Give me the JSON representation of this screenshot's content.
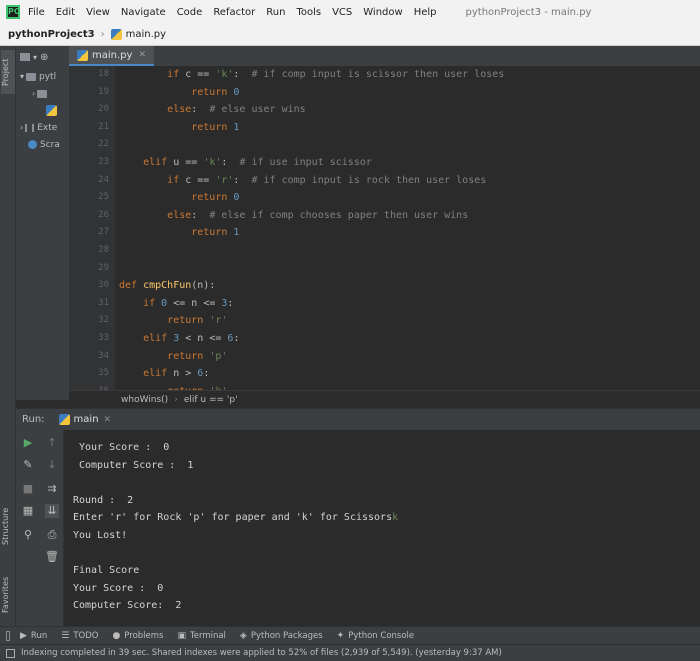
{
  "menubar": {
    "app_icon": "pycharm-logo",
    "items": [
      "File",
      "Edit",
      "View",
      "Navigate",
      "Code",
      "Refactor",
      "Run",
      "Tools",
      "VCS",
      "Window",
      "Help"
    ],
    "window_title": "pythonProject3 - main.py"
  },
  "navbar": {
    "project": "pythonProject3",
    "file": "main.py"
  },
  "left_strip": {
    "project_tab": "Project",
    "structure_tab": "Structure",
    "favorites_tab": "Favorites"
  },
  "project_panel": {
    "rows": [
      {
        "label": "pytl"
      },
      {
        "label": ""
      },
      {
        "label": ""
      },
      {
        "label": "Exte"
      },
      {
        "label": "Scra"
      }
    ]
  },
  "editor": {
    "tab": "main.py",
    "code_lines": [
      {
        "n": "18",
        "segments": [
          [
            "",
            "        "
          ],
          [
            "kw",
            "if"
          ],
          [
            "",
            " c == "
          ],
          [
            "str",
            "'k'"
          ],
          [
            "",
            ":  "
          ],
          [
            "cmt",
            "# if comp input is scissor then user loses"
          ]
        ]
      },
      {
        "n": "19",
        "segments": [
          [
            "",
            "            "
          ],
          [
            "kw",
            "return"
          ],
          [
            "",
            " "
          ],
          [
            "num",
            "0"
          ]
        ]
      },
      {
        "n": "20",
        "segments": [
          [
            "",
            "        "
          ],
          [
            "kw",
            "else"
          ],
          [
            "",
            ":  "
          ],
          [
            "cmt",
            "# else user wins"
          ]
        ]
      },
      {
        "n": "21",
        "segments": [
          [
            "",
            "            "
          ],
          [
            "kw",
            "return"
          ],
          [
            "",
            " "
          ],
          [
            "num",
            "1"
          ]
        ]
      },
      {
        "n": "22",
        "segments": []
      },
      {
        "n": "23",
        "segments": [
          [
            "",
            "    "
          ],
          [
            "kw",
            "elif"
          ],
          [
            "",
            " u == "
          ],
          [
            "str",
            "'k'"
          ],
          [
            "",
            ":  "
          ],
          [
            "cmt",
            "# if use input scissor"
          ]
        ]
      },
      {
        "n": "24",
        "segments": [
          [
            "",
            "        "
          ],
          [
            "kw",
            "if"
          ],
          [
            "",
            " c == "
          ],
          [
            "str",
            "'r'"
          ],
          [
            "",
            ":  "
          ],
          [
            "cmt",
            "# if comp input is rock then user loses"
          ]
        ]
      },
      {
        "n": "25",
        "segments": [
          [
            "",
            "            "
          ],
          [
            "kw",
            "return"
          ],
          [
            "",
            " "
          ],
          [
            "num",
            "0"
          ]
        ]
      },
      {
        "n": "26",
        "segments": [
          [
            "",
            "        "
          ],
          [
            "kw",
            "else"
          ],
          [
            "",
            ":  "
          ],
          [
            "cmt",
            "# else if comp chooses paper then user wins"
          ]
        ]
      },
      {
        "n": "27",
        "segments": [
          [
            "",
            "            "
          ],
          [
            "kw",
            "return"
          ],
          [
            "",
            " "
          ],
          [
            "num",
            "1"
          ]
        ]
      },
      {
        "n": "28",
        "segments": []
      },
      {
        "n": "29",
        "segments": []
      },
      {
        "n": "30",
        "segments": [
          [
            "kw",
            "def"
          ],
          [
            "",
            " "
          ],
          [
            "fn",
            "cmpChFun"
          ],
          [
            "",
            "(n):"
          ]
        ]
      },
      {
        "n": "31",
        "segments": [
          [
            "",
            "    "
          ],
          [
            "kw",
            "if"
          ],
          [
            "",
            " "
          ],
          [
            "num",
            "0"
          ],
          [
            "",
            " <= n <= "
          ],
          [
            "num",
            "3"
          ],
          [
            "",
            ":"
          ]
        ]
      },
      {
        "n": "32",
        "segments": [
          [
            "",
            "        "
          ],
          [
            "kw",
            "return"
          ],
          [
            "",
            " "
          ],
          [
            "str",
            "'r'"
          ]
        ]
      },
      {
        "n": "33",
        "segments": [
          [
            "",
            "    "
          ],
          [
            "kw",
            "elif"
          ],
          [
            "",
            " "
          ],
          [
            "num",
            "3"
          ],
          [
            "",
            " < n <= "
          ],
          [
            "num",
            "6"
          ],
          [
            "",
            ":"
          ]
        ]
      },
      {
        "n": "34",
        "segments": [
          [
            "",
            "        "
          ],
          [
            "kw",
            "return"
          ],
          [
            "",
            " "
          ],
          [
            "str",
            "'p'"
          ]
        ]
      },
      {
        "n": "35",
        "segments": [
          [
            "",
            "    "
          ],
          [
            "kw",
            "elif"
          ],
          [
            "",
            " n > "
          ],
          [
            "num",
            "6"
          ],
          [
            "",
            ":"
          ]
        ]
      },
      {
        "n": "36",
        "segments": [
          [
            "",
            "        "
          ],
          [
            "kw",
            "return"
          ],
          [
            "",
            " "
          ],
          [
            "str",
            "'k'"
          ]
        ]
      }
    ],
    "breadcrumb": [
      "whoWins()",
      "elif u == 'p'"
    ]
  },
  "run_panel": {
    "label": "Run:",
    "tab": "main",
    "output": [
      {
        "text": "Your Score :  0",
        "indent": true
      },
      {
        "text": "Computer Score :  1",
        "indent": true
      },
      {
        "text": "",
        "indent": false
      },
      {
        "text": "Round :  2",
        "indent": false
      },
      {
        "text": "Enter 'r' for Rock 'p' for paper and 'k' for Scissors",
        "indent": false,
        "caret": "k"
      },
      {
        "text": "You Lost!",
        "indent": false
      },
      {
        "text": "",
        "indent": false
      },
      {
        "text": "Final Score",
        "indent": false
      },
      {
        "text": "Your Score :  0",
        "indent": false
      },
      {
        "text": "Computer Score:  2",
        "indent": false
      }
    ]
  },
  "bottom_tabs": [
    {
      "icon": "play-icon",
      "label": "Run"
    },
    {
      "icon": "list-icon",
      "label": "TODO"
    },
    {
      "icon": "problems-icon",
      "label": "Problems"
    },
    {
      "icon": "terminal-icon",
      "label": "Terminal"
    },
    {
      "icon": "packages-icon",
      "label": "Python Packages"
    },
    {
      "icon": "python-console-icon",
      "label": "Python Console"
    }
  ],
  "status": "Indexing completed in 39 sec. Shared indexes were applied to 52% of files (2,939 of 5,549). (yesterday 9:37 AM)"
}
